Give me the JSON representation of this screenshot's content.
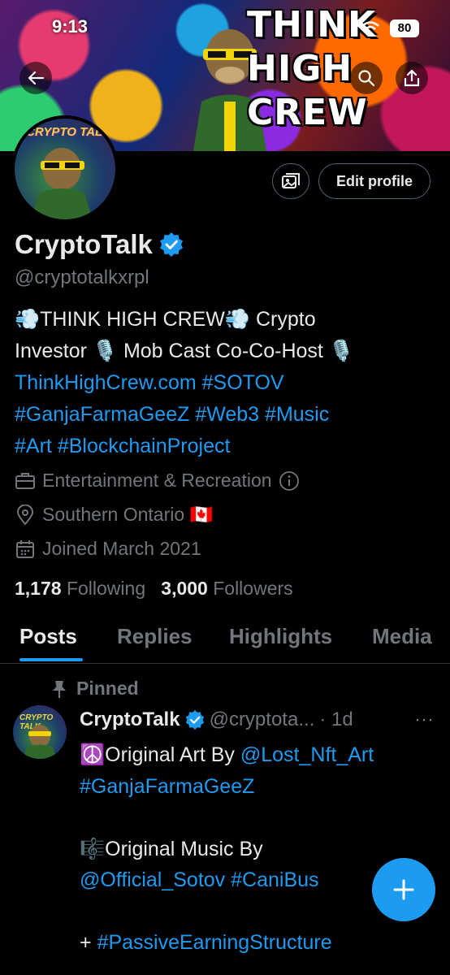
{
  "status_bar": {
    "time": "9:13",
    "battery": "80"
  },
  "banner": {
    "brand_line1": "THINK",
    "brand_line2": "HIGH",
    "brand_line3": "CREW"
  },
  "avatar": {
    "label": "CRYPTO TALK"
  },
  "profile": {
    "edit_label": "Edit profile",
    "name": "CryptoTalk",
    "handle": "@cryptotalkxrpl",
    "bio": {
      "line1_a": "💨THINK HIGH CREW💨 Crypto",
      "line2_a": "Investor 🎙️ Mob Cast Co-Co-Host 🎙️",
      "line3_link1": "ThinkHighCrew.com",
      "line3_link2": "#SOTOV",
      "line4_link1": "#GanjaFarmaGeeZ",
      "line4_link2": "#Web3",
      "line4_link3": "#Music",
      "line5_link1": "#Art",
      "line5_link2": "#BlockchainProject"
    },
    "category": "Entertainment & Recreation",
    "location": "Southern Ontario 🇨🇦",
    "joined": "Joined March 2021",
    "following_count": "1,178",
    "following_label": "Following",
    "followers_count": "3,000",
    "followers_label": "Followers"
  },
  "tabs": [
    {
      "label": "Posts",
      "active": true
    },
    {
      "label": "Replies"
    },
    {
      "label": "Highlights"
    },
    {
      "label": "Media"
    }
  ],
  "pinned_post": {
    "pinned_label": "Pinned",
    "avatar_label": "CRYPTO TALK",
    "name": "CryptoTalk",
    "handle": "@cryptota...",
    "time": "· 1d",
    "more": "···",
    "line1_text": "☮️Original Art By",
    "line1_link": "@Lost_Nft_Art",
    "line2_link": "#GanjaFarmaGeeZ",
    "line4_text": "🎼Original Music By",
    "line5_link1": "@Official_Sotov",
    "line5_link2": "#CaniBus",
    "line7_text": "+",
    "line7_link": "#PassiveEarningStructure"
  },
  "colors": {
    "accent": "#1d9bf0",
    "secondary_text": "#71767b",
    "background": "#000000"
  }
}
